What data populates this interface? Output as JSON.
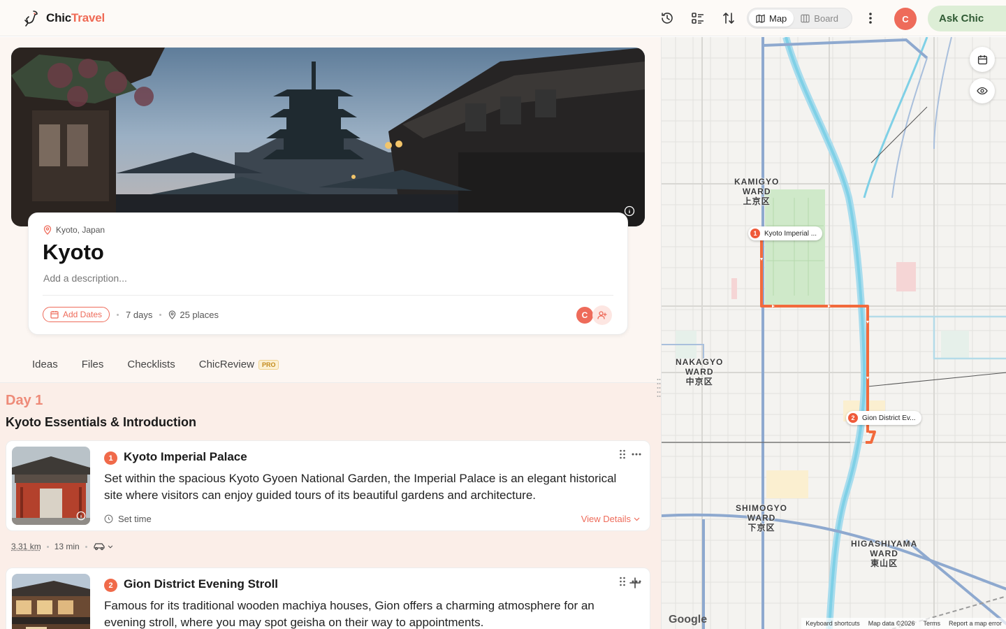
{
  "app": {
    "brand_part1": "Chic",
    "brand_part2": "Travel"
  },
  "header": {
    "icons": [
      "history-icon",
      "list-check-icon",
      "sort-icon",
      "more-vertical-icon"
    ],
    "view_toggle": {
      "map_label": "Map",
      "board_label": "Board",
      "active": "Map"
    },
    "user_initial": "C",
    "ask_label": "Ask Chic"
  },
  "trip": {
    "location": "Kyoto, Japan",
    "title": "Kyoto",
    "description_placeholder": "Add a description...",
    "add_dates_label": "Add Dates",
    "duration": "7 days",
    "places": "25 places",
    "member_initial": "C"
  },
  "tabs": [
    {
      "label": "Ideas"
    },
    {
      "label": "Files"
    },
    {
      "label": "Checklists"
    },
    {
      "label": "ChicReview",
      "badge": "PRO"
    }
  ],
  "day": {
    "label": "Day 1",
    "title": "Kyoto Essentials & Introduction",
    "places": [
      {
        "number": "1",
        "name": "Kyoto Imperial Palace",
        "description": "Set within the spacious Kyoto Gyoen National Garden, the Imperial Palace is an elegant historical site where visitors can enjoy guided tours of its beautiful gardens and architecture.",
        "time_label": "Set time",
        "details_label": "View Details"
      },
      {
        "number": "2",
        "name": "Gion District Evening Stroll",
        "description": "Famous for its traditional wooden machiya houses, Gion offers a charming atmosphere for an evening stroll, where you may spot geisha on their way to appointments."
      }
    ],
    "travel": {
      "distance": "3.31 km",
      "duration": "13 min"
    }
  },
  "map": {
    "wards": [
      {
        "line1": "KAMIGYO",
        "line2": "WARD",
        "line3": "上京区"
      },
      {
        "line1": "NAKAGYO",
        "line2": "WARD",
        "line3": "中京区"
      },
      {
        "line1": "SHIMOGYO",
        "line2": "WARD",
        "line3": "下京区"
      },
      {
        "line1": "HIGASHIYAMA",
        "line2": "WARD",
        "line3": "東山区"
      }
    ],
    "pins": [
      {
        "number": "1",
        "label": "Kyoto Imperial ..."
      },
      {
        "number": "2",
        "label": "Gion District Ev..."
      }
    ],
    "attribution": {
      "logo": "Google",
      "shortcuts": "Keyboard shortcuts",
      "data": "Map data ©2026",
      "terms": "Terms",
      "report": "Report a map error"
    },
    "colors": {
      "route": "#f26a3c",
      "river": "#7fd0e6",
      "park": "#cfe9c9",
      "highway": "#8ea9cf"
    }
  },
  "colors": {
    "accent": "#ee6b5a",
    "ask_bg": "#ddeed6",
    "day_bg": "#fbeee8"
  }
}
